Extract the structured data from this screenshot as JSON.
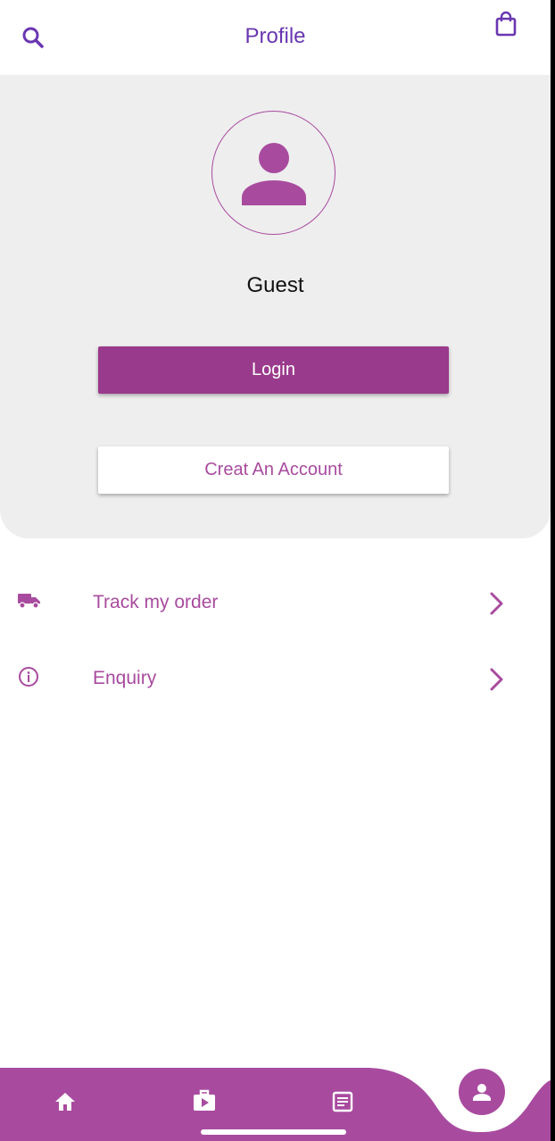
{
  "appbar": {
    "title": "Profile",
    "search_icon": "search-icon",
    "bag_icon": "shopping-bag-icon"
  },
  "profile": {
    "avatar_icon": "person-icon",
    "name": "Guest",
    "login_label": "Login",
    "create_account_label": "Creat An Account"
  },
  "menu": {
    "items": [
      {
        "label": "Track my order",
        "icon": "truck-icon"
      },
      {
        "label": "Enquiry",
        "icon": "info-icon"
      }
    ]
  },
  "bottom_nav": {
    "items": [
      "home-icon",
      "video-library-icon",
      "article-icon",
      "person-icon"
    ],
    "active": "person-icon"
  },
  "colors": {
    "primary": "#a84b9f",
    "primary_dark": "#9a3a8c",
    "title": "#6a36b0",
    "card_bg": "#eeeeee"
  }
}
